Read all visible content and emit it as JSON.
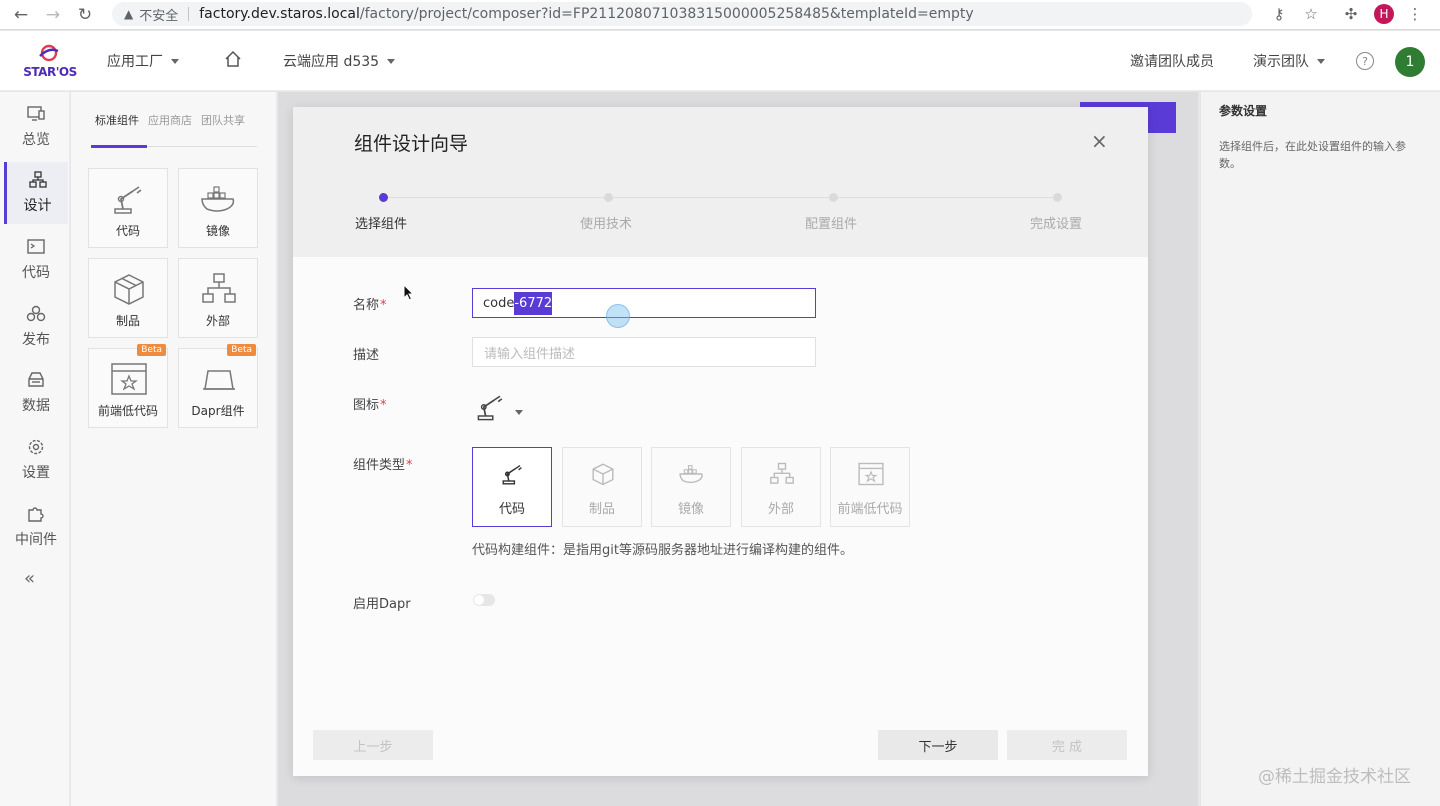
{
  "browser": {
    "insecure_label": "不安全",
    "url_host": "factory.dev.staros.local",
    "url_rest": "/factory/project/composer?id=FP211208071038315000005258485&templateId=empty",
    "profile_initial": "H"
  },
  "header": {
    "logo_text": "STAR'OS",
    "app_factory": "应用工厂",
    "project": "云端应用 d535",
    "invite": "邀请团队成员",
    "team": "演示团队",
    "help": "?",
    "avatar": "1"
  },
  "rail": {
    "items": [
      {
        "label": "总览",
        "icon": "monitor-icon"
      },
      {
        "label": "设计",
        "icon": "design-icon"
      },
      {
        "label": "代码",
        "icon": "terminal-icon"
      },
      {
        "label": "发布",
        "icon": "publish-icon"
      },
      {
        "label": "数据",
        "icon": "database-icon"
      },
      {
        "label": "设置",
        "icon": "gear-icon"
      },
      {
        "label": "中间件",
        "icon": "puzzle-icon"
      }
    ],
    "collapse": "«",
    "active_index": 1
  },
  "palette": {
    "tabs": [
      "标准组件",
      "应用商店",
      "团队共享"
    ],
    "cards": [
      {
        "label": "代码",
        "icon": "robot-arm-icon"
      },
      {
        "label": "镜像",
        "icon": "docker-icon"
      },
      {
        "label": "制品",
        "icon": "package-icon"
      },
      {
        "label": "外部",
        "icon": "external-icon"
      },
      {
        "label": "前端低代码",
        "icon": "lowcode-icon",
        "badge": "Beta"
      },
      {
        "label": "Dapr组件",
        "icon": "dapr-icon",
        "badge": "Beta"
      }
    ]
  },
  "right_panel": {
    "title": "参数设置",
    "description": "选择组件后，在此处设置组件的输入参数。"
  },
  "modal": {
    "title": "组件设计向导",
    "close": "×",
    "steps": [
      "选择组件",
      "使用技术",
      "配置组件",
      "完成设置"
    ],
    "active_step": 0,
    "fields": {
      "name_label": "名称",
      "name_prefix": "code",
      "name_selected": "-6772",
      "desc_label": "描述",
      "desc_placeholder": "请输入组件描述",
      "icon_label": "图标",
      "type_label": "组件类型",
      "dapr_label": "启用Dapr",
      "required_mark": "*"
    },
    "types": [
      {
        "label": "代码",
        "icon": "robot-arm-icon",
        "selected": true
      },
      {
        "label": "制品",
        "icon": "package-icon"
      },
      {
        "label": "镜像",
        "icon": "docker-icon"
      },
      {
        "label": "外部",
        "icon": "external-icon"
      },
      {
        "label": "前端低代码",
        "icon": "lowcode-icon"
      }
    ],
    "type_hint": "代码构建组件：是指用git等源码服务器地址进行编译构建的组件。",
    "buttons": {
      "prev": "上一步",
      "next": "下一步",
      "done": "完 成"
    },
    "dapr_enabled": false
  },
  "watermark": "@稀土掘金技术社区",
  "colors": {
    "accent": "#5b3bd6",
    "required": "#e53950",
    "avatar": "#2e7d32"
  }
}
